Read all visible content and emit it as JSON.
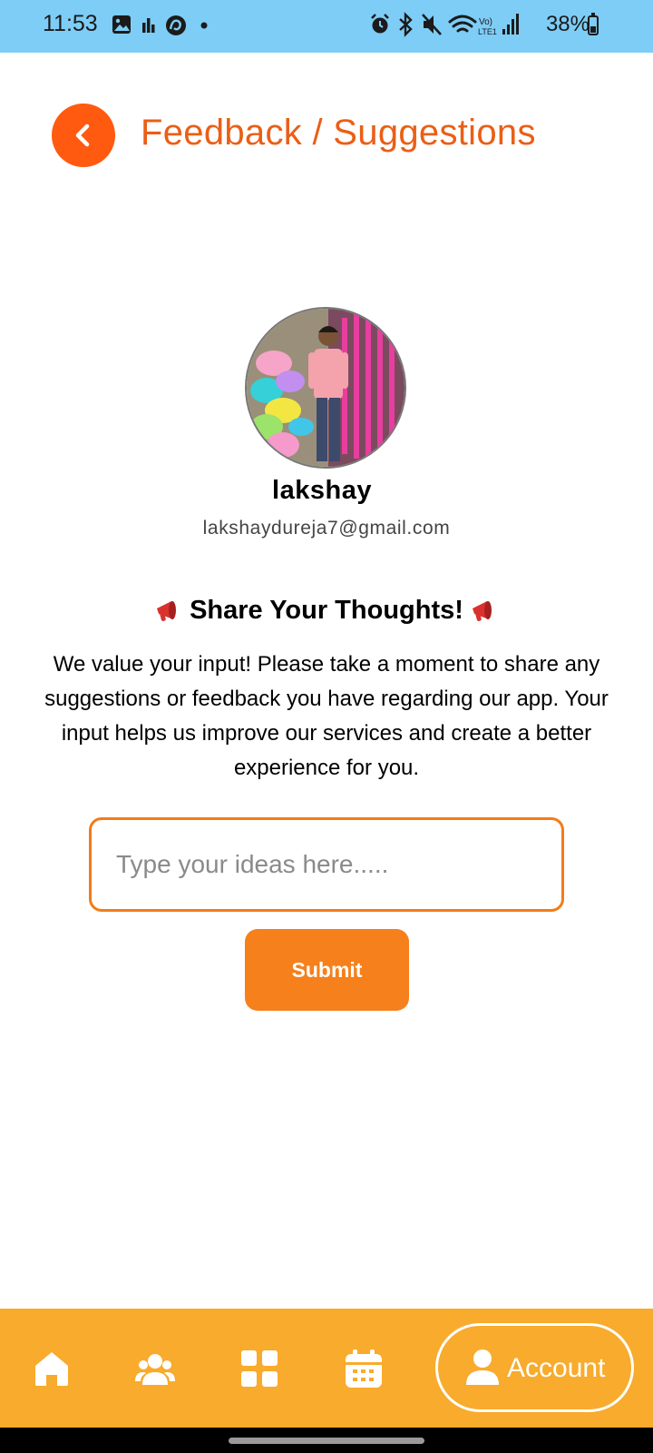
{
  "status_bar": {
    "time": "11:53",
    "battery_percent": "38%",
    "network_label": "Vo) LTE1",
    "left_icons": [
      "gallery-icon",
      "stats-icon",
      "app-icon",
      "dot-icon"
    ],
    "right_icons": [
      "alarm-icon",
      "bluetooth-icon",
      "mute-icon",
      "wifi-icon",
      "signal-icon",
      "battery-icon"
    ]
  },
  "header": {
    "title": "Feedback / Suggestions",
    "back_icon": "chevron-left-icon"
  },
  "profile": {
    "name": "lakshay",
    "email": "lakshaydureja7@gmail.com"
  },
  "intro": {
    "heading": "Share Your Thoughts!",
    "heading_icon": "megaphone-icon",
    "description": "We value your input! Please take a moment to share any suggestions or feedback you have regarding our app. Your input helps us improve our services and create a better experience for you."
  },
  "form": {
    "input_placeholder": "Type your ideas here.....",
    "input_value": "",
    "submit_label": "Submit"
  },
  "bottom_nav": {
    "items": [
      {
        "icon": "home-icon"
      },
      {
        "icon": "users-icon"
      },
      {
        "icon": "grid-icon"
      },
      {
        "icon": "calendar-icon"
      }
    ],
    "active": {
      "icon": "person-icon",
      "label": "Account"
    }
  },
  "colors": {
    "status_bar": "#7dcdf7",
    "accent": "#ea5f16",
    "back_button": "#ff5a0f",
    "input_border": "#f27c18",
    "submit": "#f5801c",
    "nav_bg": "#f8ab2c"
  }
}
